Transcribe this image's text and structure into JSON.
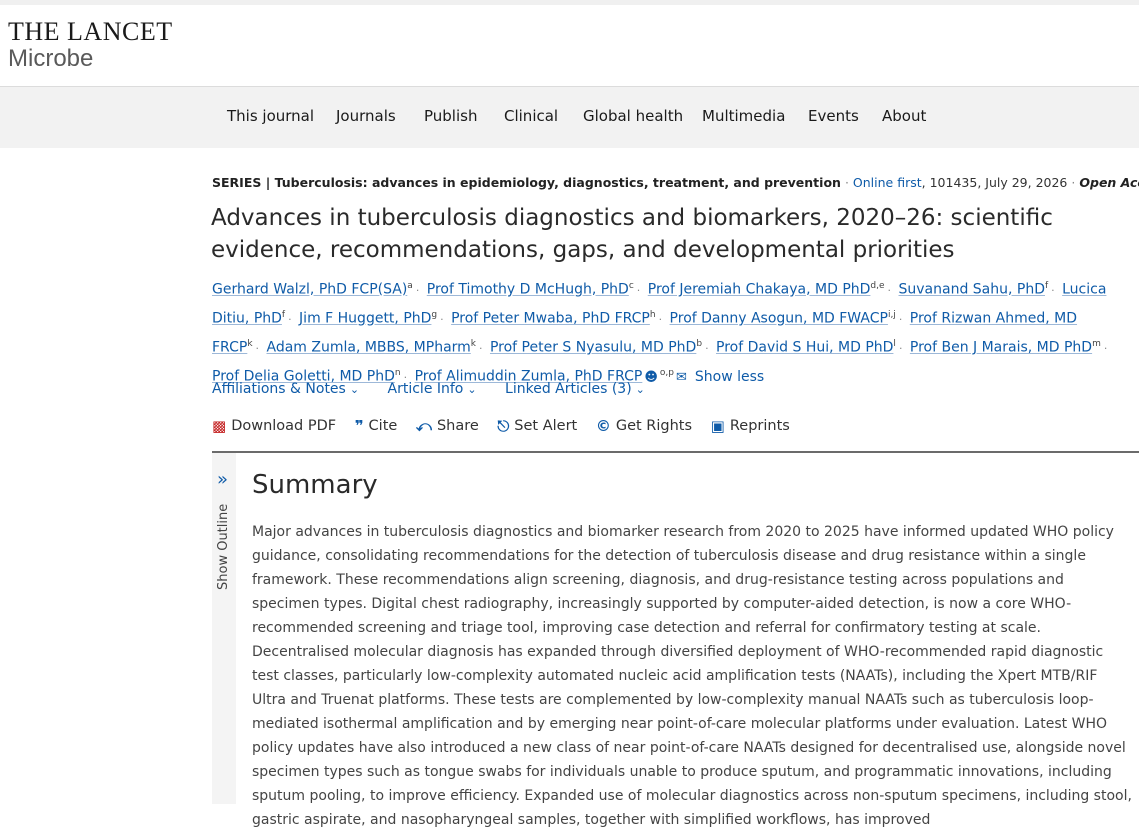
{
  "journal": {
    "name_line1": "THE LANCET",
    "name_line2": "Microbe"
  },
  "nav": [
    "This journal",
    "Journals",
    "Publish",
    "Clinical",
    "Global health",
    "Multimedia",
    "Events",
    "About"
  ],
  "article_meta": {
    "series": "SERIES | Tuberculosis: advances in epidemiology, diagnostics, treatment, and prevention",
    "online_first": "Online first",
    "citation": ", 101435, July 29, 2026",
    "open_access": "Open Access"
  },
  "title": "Advances in tuberculosis diagnostics and biomarkers, 2020–26: scientific evidence, recommendations, gaps, and developmental priorities",
  "authors": [
    {
      "name": "Gerhard Walzl, PhD FCP(SA)",
      "aff": "a"
    },
    {
      "name": "Prof Timothy D McHugh, PhD",
      "aff": "c"
    },
    {
      "name": "Prof Jeremiah Chakaya, MD PhD",
      "aff": "d,e"
    },
    {
      "name": "Suvanand Sahu, PhD",
      "aff": "f"
    },
    {
      "name": "Lucica Ditiu, PhD",
      "aff": "f"
    },
    {
      "name": "Jim F Huggett, PhD",
      "aff": "g"
    },
    {
      "name": "Prof Peter Mwaba, PhD FRCP",
      "aff": "h"
    },
    {
      "name": "Prof Danny Asogun, MD FWACP",
      "aff": "i,j"
    },
    {
      "name": "Prof Rizwan Ahmed, MD FRCP",
      "aff": "k"
    },
    {
      "name": "Adam Zumla, MBBS, MPharm",
      "aff": "k"
    },
    {
      "name": "Prof Peter S Nyasulu, MD PhD",
      "aff": "b"
    },
    {
      "name": "Prof David S Hui, MD PhD",
      "aff": "l"
    },
    {
      "name": "Prof Ben J Marais, MD PhD",
      "aff": "m"
    },
    {
      "name": "Prof Delia Goletti, MD PhD",
      "aff": "n"
    },
    {
      "name": "Prof Alimuddin Zumla, PhD FRCP",
      "aff": "o,p"
    }
  ],
  "show_less": "Show less",
  "links": {
    "affiliations": "Affiliations & Notes",
    "article_info": "Article Info",
    "linked_articles": "Linked Articles (3)"
  },
  "tools": {
    "download_pdf": "Download PDF",
    "cite": "Cite",
    "share": "Share",
    "set_alert": "Set Alert",
    "get_rights": "Get Rights",
    "reprints": "Reprints"
  },
  "outline": {
    "label": "Show Outline"
  },
  "summary": {
    "heading": "Summary",
    "text": "Major advances in tuberculosis diagnostics and biomarker research from 2020 to 2025 have informed updated WHO policy guidance, consolidating recommendations for the detection of tuberculosis disease and drug resistance within a single framework. These recommendations align screening, diagnosis, and drug-resistance testing across populations and specimen types. Digital chest radiography, increasingly supported by computer-aided detection, is now a core WHO-recommended screening and triage tool, improving case detection and referral for confirmatory testing at scale. Decentralised molecular diagnosis has expanded through diversified deployment of WHO-recommended rapid diagnostic test classes, particularly low-complexity automated nucleic acid amplification tests (NAATs), including the Xpert MTB/RIF Ultra and Truenat platforms. These tests are complemented by low-complexity manual NAATs such as tuberculosis loop-mediated isothermal amplification and by emerging near point-of-care molecular platforms under evaluation. Latest WHO policy updates have also introduced a new class of near point-of-care NAATs designed for decentralised use, alongside novel specimen types such as tongue swabs for individuals unable to produce sputum, and programmatic innovations, including sputum pooling, to improve efficiency. Expanded use of molecular diagnostics across non-sputum specimens, including stool, gastric aspirate, and nasopharyngeal samples, together with simplified workflows, has improved"
  },
  "colors": {
    "link": "#0f5ba8",
    "pdf_icon": "#c21b1b",
    "nav_bg": "#f2f2f2"
  }
}
